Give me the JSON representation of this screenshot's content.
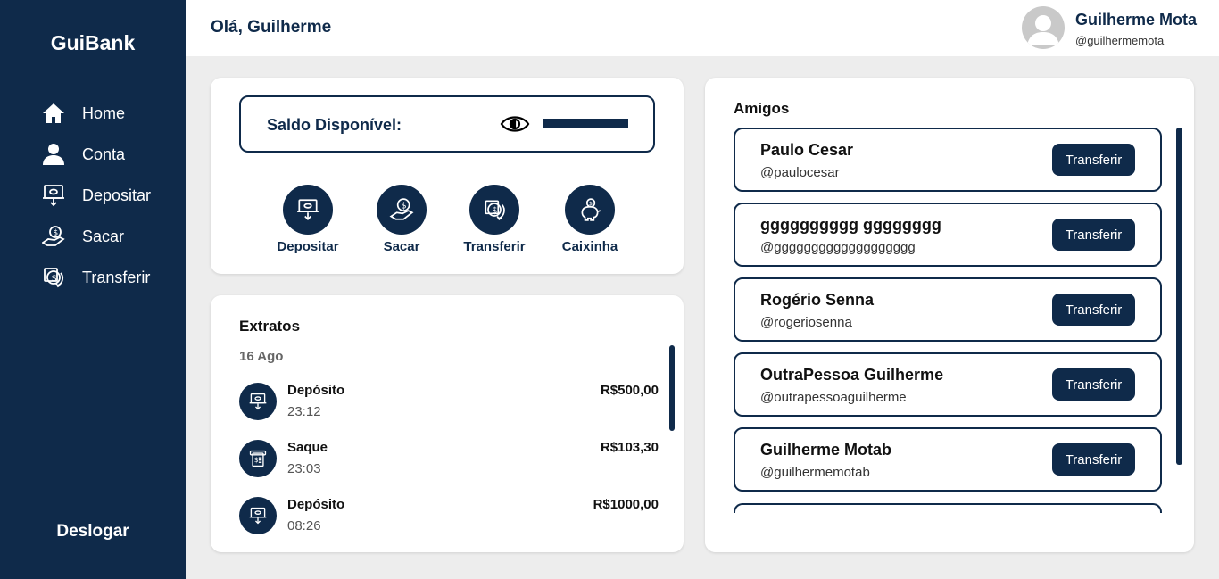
{
  "sidebar": {
    "brand": "GuiBank",
    "items": [
      {
        "label": "Home",
        "icon": "home-icon"
      },
      {
        "label": "Conta",
        "icon": "user-icon"
      },
      {
        "label": "Depositar",
        "icon": "deposit-icon"
      },
      {
        "label": "Sacar",
        "icon": "withdraw-icon"
      },
      {
        "label": "Transferir",
        "icon": "transfer-icon"
      }
    ],
    "logout_label": "Deslogar"
  },
  "header": {
    "greeting": "Olá, Guilherme",
    "user_name": "Guilherme Mota",
    "user_handle": "@guilhermemota"
  },
  "balance": {
    "label": "Saldo Disponível:",
    "eye_icon": "eye-icon"
  },
  "actions": [
    {
      "label": "Depositar",
      "icon": "deposit-icon"
    },
    {
      "label": "Sacar",
      "icon": "withdraw-icon"
    },
    {
      "label": "Transferir",
      "icon": "transfer-icon"
    },
    {
      "label": "Caixinha",
      "icon": "piggy-bank-icon"
    }
  ],
  "statement": {
    "title": "Extratos",
    "date": "16 Ago",
    "transactions": [
      {
        "name": "Depósito",
        "time": "23:12",
        "amount": "R$500,00",
        "icon": "deposit-icon"
      },
      {
        "name": "Saque",
        "time": "23:03",
        "amount": "R$103,30",
        "icon": "atm-icon"
      },
      {
        "name": "Depósito",
        "time": "08:26",
        "amount": "R$1000,00",
        "icon": "deposit-icon"
      }
    ]
  },
  "friends": {
    "title": "Amigos",
    "button_label": "Transferir",
    "list": [
      {
        "name": "Paulo Cesar",
        "handle": "@paulocesar"
      },
      {
        "name": "gggggggggg gggggggg",
        "handle": "@ggggggggggggggggggg"
      },
      {
        "name": "Rogério Senna",
        "handle": "@rogeriosenna"
      },
      {
        "name": "OutraPessoa Guilherme",
        "handle": "@outrapessoaguilherme"
      },
      {
        "name": "Guilherme Motab",
        "handle": "@guilhermemotab"
      }
    ]
  },
  "colors": {
    "primary": "#0f2a4a",
    "background": "#ededed",
    "surface": "#ffffff"
  }
}
